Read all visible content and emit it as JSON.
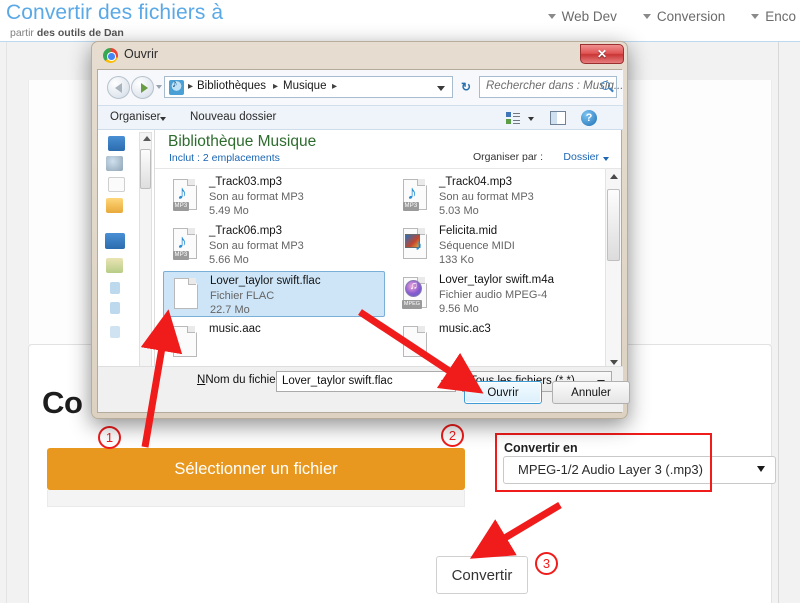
{
  "site": {
    "title": "Convertir des fichiers à",
    "subtitle_light": "partir",
    "subtitle_bold": "des outils de Dan",
    "nav": [
      {
        "label": "Web Dev"
      },
      {
        "label": "Conversion"
      },
      {
        "label": "Enco"
      }
    ]
  },
  "main": {
    "heading": "Co",
    "select_file_button": "Sélectionner un fichier",
    "convert_to_label": "Convertir en",
    "convert_to_value": "MPEG-1/2 Audio Layer 3 (.mp3)",
    "convert_button": "Convertir",
    "steps": [
      "1",
      "2",
      "3"
    ],
    "accent_orange": "#e8981f",
    "highlight_red": "#f01b1b"
  },
  "dialog": {
    "title": "Ouvrir",
    "ghost_title": "Convertir des fichiers a",
    "close_label": "✕",
    "address": {
      "crumbs": [
        "Bibliothèques",
        "Musique"
      ],
      "separator": "▸",
      "refresh": "↻",
      "search_placeholder": "Rechercher dans : Musiq..."
    },
    "toolbar": {
      "organize": "Organiser",
      "new_folder": "Nouveau dossier",
      "help": "?"
    },
    "library": {
      "title": "Bibliothèque Musique",
      "includes_label": "Inclut :",
      "includes_value": "2 emplacements",
      "organize_by_label": "Organiser par :",
      "organize_by_value": "Dossier"
    },
    "files": [
      {
        "name": "_Track03.mp3",
        "type": "Son au format MP3",
        "size": "5.49 Mo",
        "icon": "mp3-file-icon",
        "selected": false
      },
      {
        "name": "_Track04.mp3",
        "type": "Son au format MP3",
        "size": "5.03 Mo",
        "icon": "mp3-file-icon",
        "selected": false
      },
      {
        "name": "_Track06.mp3",
        "type": "Son au format MP3",
        "size": "5.66 Mo",
        "icon": "mp3-file-icon",
        "selected": false
      },
      {
        "name": "Felicita.mid",
        "type": "Séquence MIDI",
        "size": "133 Ko",
        "icon": "midi-file-icon",
        "selected": false
      },
      {
        "name": "Lover_taylor swift.flac",
        "type": "Fichier FLAC",
        "size": "22.7 Mo",
        "icon": "generic-file-icon",
        "selected": true
      },
      {
        "name": "Lover_taylor swift.m4a",
        "type": "Fichier audio MPEG-4",
        "size": "9.56 Mo",
        "icon": "m4a-file-icon",
        "selected": false
      },
      {
        "name": "music.aac",
        "type": "",
        "size": "",
        "icon": "generic-file-icon",
        "selected": false
      },
      {
        "name": "music.ac3",
        "type": "",
        "size": "",
        "icon": "generic-file-icon",
        "selected": false
      }
    ],
    "footer": {
      "filename_label": "Nom du fichier :",
      "filename_value": "Lover_taylor swift.flac",
      "filter_value": "Tous les fichiers (*.*)",
      "open_button": "Ouvrir",
      "cancel_button": "Annuler"
    }
  }
}
